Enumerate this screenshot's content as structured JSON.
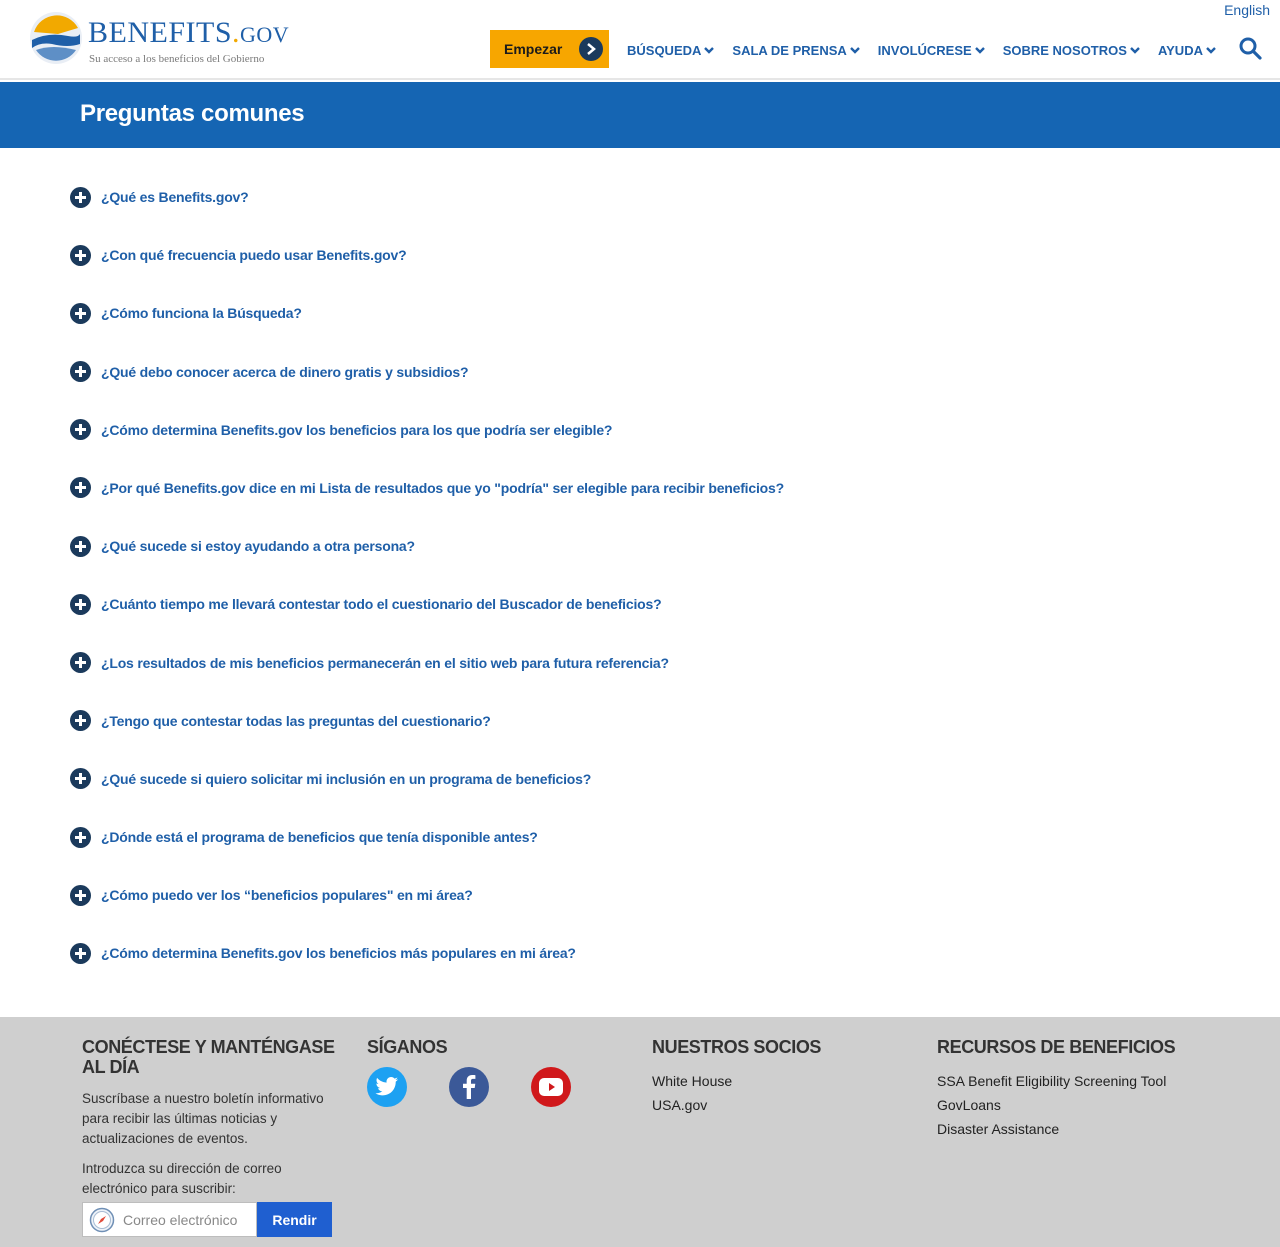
{
  "header": {
    "logo_name": "BENEFITS",
    "logo_dot": ".",
    "logo_suffix": "GOV",
    "logo_tagline": "Su acceso a los beneficios del Gobierno",
    "language_link": "English",
    "start_button": "Empezar",
    "nav": [
      "BÚSQUEDA",
      "SALA DE PRENSA",
      "INVOLÚCRESE",
      "SOBRE NOSOTROS",
      "AYUDA"
    ]
  },
  "banner": {
    "title": "Preguntas comunes"
  },
  "faq": [
    "¿Qué es Benefits.gov?",
    "¿Con qué frecuencia puedo usar Benefits.gov?",
    "¿Cómo funciona la Búsqueda?",
    "¿Qué debo conocer acerca de dinero gratis y subsidios?",
    "¿Cómo determina Benefits.gov los beneficios para los que podría ser elegible?",
    "¿Por qué Benefits.gov dice en mi Lista de resultados que yo \"podría\" ser elegible para recibir beneficios?",
    "¿Qué sucede si estoy ayudando a otra persona?",
    "¿Cuánto tiempo me llevará contestar todo el cuestionario del Buscador de beneficios?",
    "¿Los resultados de mis beneficios permanecerán en el sitio web para futura referencia?",
    "¿Tengo que contestar todas las preguntas del cuestionario?",
    "¿Qué sucede si quiero solicitar mi inclusión en un programa de beneficios?",
    "¿Dónde está el programa de beneficios que tenía disponible antes?",
    "¿Cómo puedo ver los “beneficios populares\" en mi área?",
    "¿Cómo determina Benefits.gov los beneficios más populares en mi área?"
  ],
  "footer": {
    "connect": {
      "title": "CONÉCTESE Y MANTÉNGASE AL DÍA",
      "description": "Suscríbase a nuestro boletín informativo para recibir las últimas noticias y actualizaciones de eventos.",
      "prompt": "Introduzca su dirección de correo electrónico para suscribir:",
      "email_placeholder": "Correo electrónico",
      "submit": "Rendir"
    },
    "follow": {
      "title": "SÍGANOS",
      "icons": [
        "twitter-icon",
        "facebook-icon",
        "youtube-icon"
      ]
    },
    "partners": {
      "title": "NUESTROS SOCIOS",
      "links": [
        "White House",
        "USA.gov"
      ]
    },
    "resources": {
      "title": "RECURSOS DE BENEFICIOS",
      "links": [
        "SSA Benefit Eligibility Screening Tool",
        "GovLoans",
        "Disaster Assistance"
      ]
    }
  },
  "colors": {
    "brand_blue": "#1f5fa8",
    "banner_blue": "#1565b3",
    "start_orange": "#f7a600",
    "footer_gray": "#cfcfcf"
  }
}
